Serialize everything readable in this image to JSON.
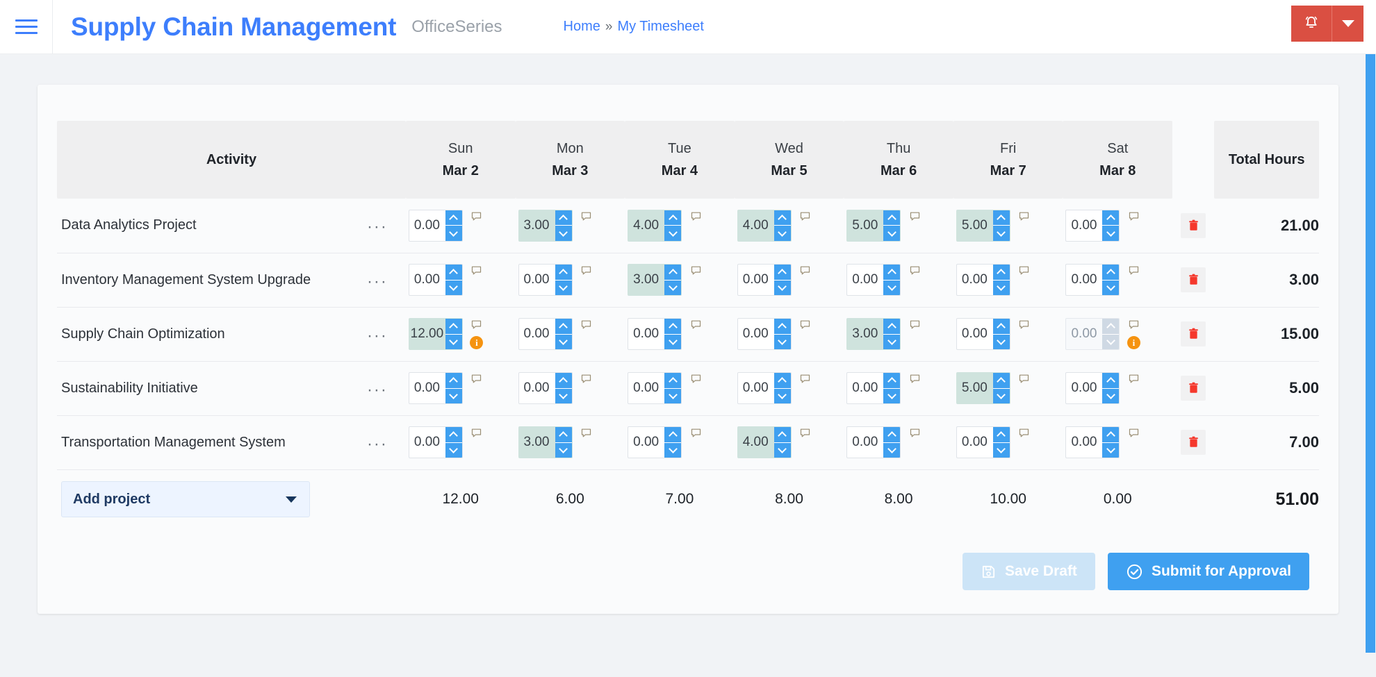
{
  "header": {
    "menu_icon": "hamburger-icon",
    "brand": "Supply Chain Management",
    "brand_suffix": "OfficeSeries",
    "breadcrumb": {
      "home": "Home",
      "separator": "»",
      "current": "My Timesheet"
    },
    "notifications_icon": "bell-icon",
    "notifications_caret_icon": "chevron-down-icon",
    "accent_color": "#3d7efc",
    "alert_color": "#da4f42"
  },
  "table": {
    "columns": [
      {
        "label": "Activity"
      },
      {
        "dow": "Sun",
        "date": "Mar 2"
      },
      {
        "dow": "Mon",
        "date": "Mar 3"
      },
      {
        "dow": "Tue",
        "date": "Mar 4"
      },
      {
        "dow": "Wed",
        "date": "Mar 5"
      },
      {
        "dow": "Thu",
        "date": "Mar 6"
      },
      {
        "dow": "Fri",
        "date": "Mar 7"
      },
      {
        "dow": "Sat",
        "date": "Mar 8"
      },
      {
        "label": "Total Hours"
      }
    ],
    "rows": [
      {
        "activity": "Data Analytics Project",
        "menu_icon": "ellipsis-icon",
        "delete_icon": "trash-icon",
        "hours": [
          {
            "value": "0.00",
            "filled": false,
            "disabled": false,
            "warning": false
          },
          {
            "value": "3.00",
            "filled": true,
            "disabled": false,
            "warning": false
          },
          {
            "value": "4.00",
            "filled": true,
            "disabled": false,
            "warning": false
          },
          {
            "value": "4.00",
            "filled": true,
            "disabled": false,
            "warning": false
          },
          {
            "value": "5.00",
            "filled": true,
            "disabled": false,
            "warning": false
          },
          {
            "value": "5.00",
            "filled": true,
            "disabled": false,
            "warning": false
          },
          {
            "value": "0.00",
            "filled": false,
            "disabled": false,
            "warning": false
          }
        ],
        "total": "21.00"
      },
      {
        "activity": "Inventory Management System Upgrade",
        "menu_icon": "ellipsis-icon",
        "delete_icon": "trash-icon",
        "hours": [
          {
            "value": "0.00",
            "filled": false,
            "disabled": false,
            "warning": false
          },
          {
            "value": "0.00",
            "filled": false,
            "disabled": false,
            "warning": false
          },
          {
            "value": "3.00",
            "filled": true,
            "disabled": false,
            "warning": false
          },
          {
            "value": "0.00",
            "filled": false,
            "disabled": false,
            "warning": false
          },
          {
            "value": "0.00",
            "filled": false,
            "disabled": false,
            "warning": false
          },
          {
            "value": "0.00",
            "filled": false,
            "disabled": false,
            "warning": false
          },
          {
            "value": "0.00",
            "filled": false,
            "disabled": false,
            "warning": false
          }
        ],
        "total": "3.00"
      },
      {
        "activity": "Supply Chain Optimization",
        "menu_icon": "ellipsis-icon",
        "delete_icon": "trash-icon",
        "hours": [
          {
            "value": "12.00",
            "filled": true,
            "disabled": false,
            "warning": true
          },
          {
            "value": "0.00",
            "filled": false,
            "disabled": false,
            "warning": false
          },
          {
            "value": "0.00",
            "filled": false,
            "disabled": false,
            "warning": false
          },
          {
            "value": "0.00",
            "filled": false,
            "disabled": false,
            "warning": false
          },
          {
            "value": "3.00",
            "filled": true,
            "disabled": false,
            "warning": false
          },
          {
            "value": "0.00",
            "filled": false,
            "disabled": false,
            "warning": false
          },
          {
            "value": "0.00",
            "filled": false,
            "disabled": true,
            "warning": true
          }
        ],
        "total": "15.00"
      },
      {
        "activity": "Sustainability Initiative",
        "menu_icon": "ellipsis-icon",
        "delete_icon": "trash-icon",
        "hours": [
          {
            "value": "0.00",
            "filled": false,
            "disabled": false,
            "warning": false
          },
          {
            "value": "0.00",
            "filled": false,
            "disabled": false,
            "warning": false
          },
          {
            "value": "0.00",
            "filled": false,
            "disabled": false,
            "warning": false
          },
          {
            "value": "0.00",
            "filled": false,
            "disabled": false,
            "warning": false
          },
          {
            "value": "0.00",
            "filled": false,
            "disabled": false,
            "warning": false
          },
          {
            "value": "5.00",
            "filled": true,
            "disabled": false,
            "warning": false
          },
          {
            "value": "0.00",
            "filled": false,
            "disabled": false,
            "warning": false
          }
        ],
        "total": "5.00"
      },
      {
        "activity": "Transportation Management System",
        "menu_icon": "ellipsis-icon",
        "delete_icon": "trash-icon",
        "hours": [
          {
            "value": "0.00",
            "filled": false,
            "disabled": false,
            "warning": false
          },
          {
            "value": "3.00",
            "filled": true,
            "disabled": false,
            "warning": false
          },
          {
            "value": "0.00",
            "filled": false,
            "disabled": false,
            "warning": false
          },
          {
            "value": "4.00",
            "filled": true,
            "disabled": false,
            "warning": false
          },
          {
            "value": "0.00",
            "filled": false,
            "disabled": false,
            "warning": false
          },
          {
            "value": "0.00",
            "filled": false,
            "disabled": false,
            "warning": false
          },
          {
            "value": "0.00",
            "filled": false,
            "disabled": false,
            "warning": false
          }
        ],
        "total": "7.00"
      }
    ],
    "footer": {
      "add_project_label": "Add project",
      "add_project_caret_icon": "chevron-down-icon",
      "day_totals": [
        "12.00",
        "6.00",
        "7.00",
        "8.00",
        "8.00",
        "10.00",
        "0.00"
      ],
      "grand_total": "51.00"
    },
    "comment_icon": "comment-icon",
    "warning_icon": "info-warning-icon",
    "spinner_up_icon": "chevron-up-icon",
    "spinner_down_icon": "chevron-down-icon",
    "filled_cell_color": "#cfe3dd",
    "spinner_color": "#3fa0f0",
    "warning_color": "#f59310",
    "delete_color": "#f5382c"
  },
  "actions": {
    "save_draft_label": "Save Draft",
    "save_draft_icon": "save-disk-icon",
    "submit_label": "Submit for Approval",
    "submit_icon": "check-circle-icon",
    "submit_color": "#3fa0f0"
  }
}
